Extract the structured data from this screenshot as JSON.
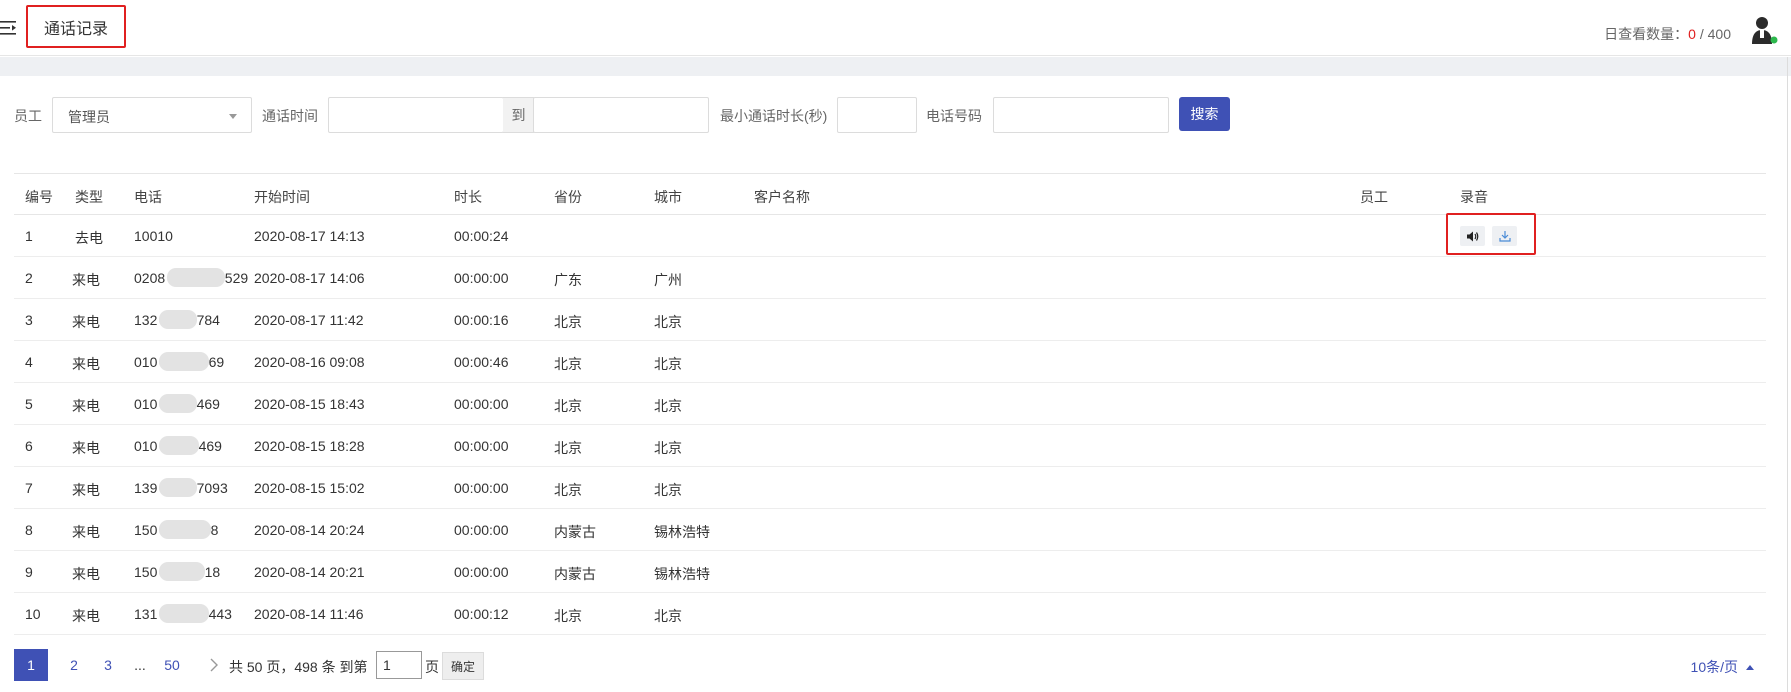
{
  "header": {
    "title": "通话记录",
    "view_count_label": "日查看数量：",
    "view_count_used": "0",
    "view_count_sep": " / ",
    "view_count_total": "400"
  },
  "filters": {
    "staff_label": "员工",
    "staff_value": "管理员",
    "time_label": "通话时间",
    "date_separator": "到",
    "min_duration_label": "最小通话时长(秒)",
    "phone_label": "电话号码",
    "search_button": "搜索"
  },
  "table": {
    "columns": [
      "编号",
      "类型",
      "电话",
      "开始时间",
      "时长",
      "省份",
      "城市",
      "客户名称",
      "员工",
      "录音"
    ],
    "rows": [
      {
        "no": "1",
        "type": "去电",
        "phone_a": "10010",
        "phone_b": "",
        "start": "2020-08-17 14:13",
        "duration": "00:00:24",
        "province": "",
        "city": "",
        "has_recording": true
      },
      {
        "no": "2",
        "type": "来电",
        "phone_a": "0208",
        "phone_b": "529",
        "start": "2020-08-17 14:06",
        "duration": "00:00:00",
        "province": "广东",
        "city": "广州",
        "has_recording": false
      },
      {
        "no": "3",
        "type": "来电",
        "phone_a": "132",
        "phone_b": "784",
        "start": "2020-08-17 11:42",
        "duration": "00:00:16",
        "province": "北京",
        "city": "北京",
        "has_recording": false
      },
      {
        "no": "4",
        "type": "来电",
        "phone_a": "010",
        "phone_b": "69",
        "start": "2020-08-16 09:08",
        "duration": "00:00:46",
        "province": "北京",
        "city": "北京",
        "has_recording": false
      },
      {
        "no": "5",
        "type": "来电",
        "phone_a": "010",
        "phone_b": "469",
        "start": "2020-08-15 18:43",
        "duration": "00:00:00",
        "province": "北京",
        "city": "北京",
        "has_recording": false
      },
      {
        "no": "6",
        "type": "来电",
        "phone_a": "010",
        "phone_b": "469",
        "start": "2020-08-15 18:28",
        "duration": "00:00:00",
        "province": "北京",
        "city": "北京",
        "has_recording": false
      },
      {
        "no": "7",
        "type": "来电",
        "phone_a": "139",
        "phone_b": "7093",
        "start": "2020-08-15 15:02",
        "duration": "00:00:00",
        "province": "北京",
        "city": "北京",
        "has_recording": false
      },
      {
        "no": "8",
        "type": "来电",
        "phone_a": "150",
        "phone_b": "8",
        "start": "2020-08-14 20:24",
        "duration": "00:00:00",
        "province": "内蒙古",
        "city": "锡林浩特",
        "has_recording": false
      },
      {
        "no": "9",
        "type": "来电",
        "phone_a": "150",
        "phone_b": "18",
        "start": "2020-08-14 20:21",
        "duration": "00:00:00",
        "province": "内蒙古",
        "city": "锡林浩特",
        "has_recording": false
      },
      {
        "no": "10",
        "type": "来电",
        "phone_a": "131",
        "phone_b": "443",
        "start": "2020-08-14 11:46",
        "duration": "00:00:12",
        "province": "北京",
        "city": "北京",
        "has_recording": false
      }
    ]
  },
  "pagination": {
    "pages": [
      "1",
      "2",
      "3",
      "...",
      "50"
    ],
    "current": "1",
    "summary": "共 50 页，498 条 到第",
    "goto_value": "1",
    "page_unit": "页",
    "confirm": "确定",
    "per_page": "10条/页"
  },
  "icons": {
    "menu": "menu-indent-icon",
    "avatar": "user-avatar-icon",
    "play": "speaker-icon",
    "download": "download-icon",
    "next": "chevron-right-icon"
  },
  "colors": {
    "accent": "#3f51b5",
    "highlight_box": "#e02020",
    "online": "#2db84d"
  }
}
